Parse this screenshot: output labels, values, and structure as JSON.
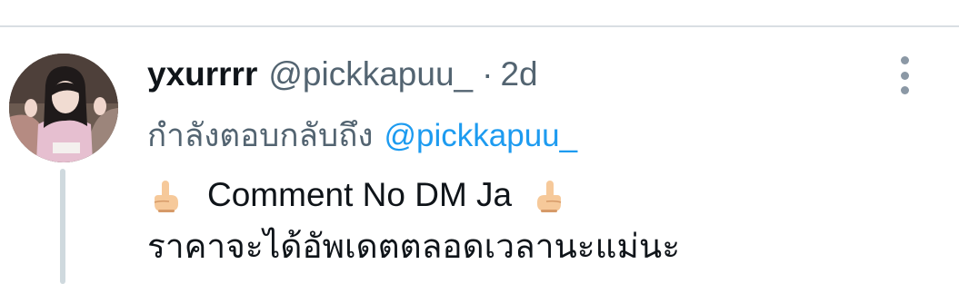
{
  "tweet": {
    "display_name": "yxurrrr",
    "handle": "@pickkapuu_",
    "separator": "·",
    "timestamp": "2d",
    "reply_prefix": "กำลังตอบกลับถึง",
    "reply_to": "@pickkapuu_",
    "text_line1": "Comment No DM Ja",
    "text_line2": "ราคาจะได้อัพเดตตลอดเวลานะแม่นะ",
    "emoji_icon": "raised-back-of-hand-icon"
  },
  "colors": {
    "name": "#0f1419",
    "secondary": "#536471",
    "mention": "#1d9bf0",
    "thread_line": "#cfd9de",
    "divider": "#d9dee3"
  }
}
